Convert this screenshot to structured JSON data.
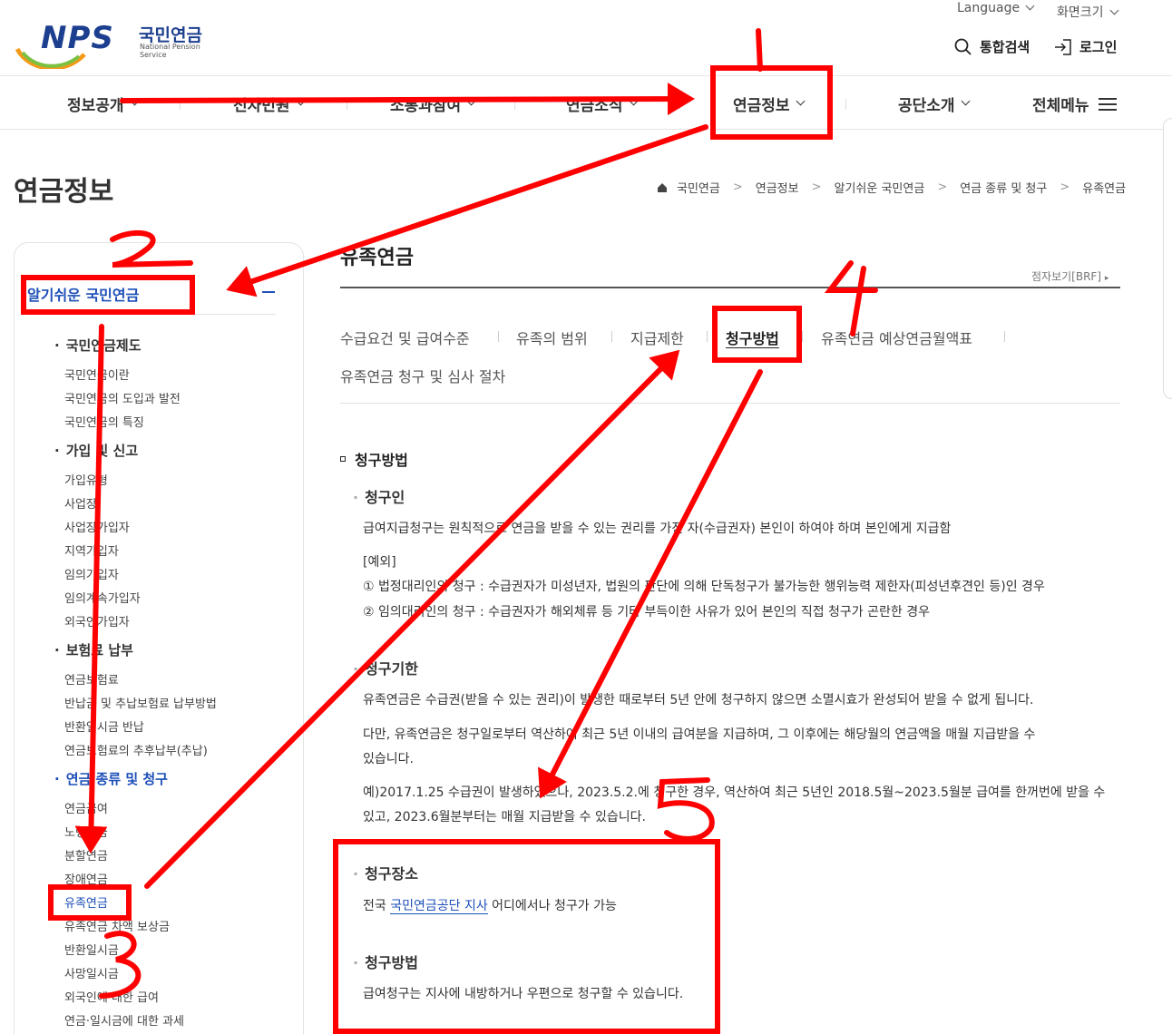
{
  "header": {
    "logo": {
      "brand": "NPS",
      "name_ko": "국민연금",
      "name_en": "National Pension Service"
    },
    "utility": {
      "language": "Language",
      "zoom": "화면크기",
      "search": "통합검색",
      "login": "로그인"
    },
    "gnb": [
      "정보공개",
      "전자민원",
      "소통과참여",
      "연금소식",
      "연금정보",
      "공단소개",
      "전체메뉴"
    ]
  },
  "page_title": "연금정보",
  "breadcrumb": [
    "국민연금",
    "연금정보",
    "알기쉬운 국민연금",
    "연금 종류 및 청구",
    "유족연금"
  ],
  "sidebar": {
    "heading": "알기쉬운 국민연금",
    "groups": [
      {
        "label": "국민연금제도",
        "items": [
          "국민연금이란",
          "국민연금의 도입과 발전",
          "국민연금의 특징"
        ]
      },
      {
        "label": "가입 및 신고",
        "items": [
          "가입유형",
          "사업장",
          "사업장가입자",
          "지역가입자",
          "임의가입자",
          "임의계속가입자",
          "외국인가입자"
        ]
      },
      {
        "label": "보험료 납부",
        "items": [
          "연금보험료",
          "반납금 및 추납보험료 납부방법",
          "반환일시금 반납",
          "연금보험료의 추후납부(추납)"
        ]
      },
      {
        "label": "연금 종류 및 청구",
        "items": [
          "연금급여",
          "노령연금",
          "분할연금",
          "장애연금",
          "유족연금",
          "유족연금 차액 보상금",
          "반환일시금",
          "사망일시금",
          "외국인에 대한 급여",
          "연금·일시금에 대한 과세"
        ]
      }
    ]
  },
  "content": {
    "title": "유족연금",
    "braille": "점자보기[BRF]",
    "tabs": [
      "수급요건 및 급여수준",
      "유족의 범위",
      "지급제한",
      "청구방법",
      "유족연금 예상연금월액표",
      "유족연금 청구 및 심사 절차"
    ],
    "section_title": "청구방법",
    "claimant": {
      "title": "청구인",
      "text": "급여지급청구는 원칙적으로 연금을 받을 수 있는 권리를 가진 자(수급권자) 본인이 하여야 하며 본인에게 지급함",
      "example_label": "[예외]",
      "example1": "① 법정대리인의 청구 : 수급권자가 미성년자, 법원의 판단에 의해 단독청구가 불가능한 행위능력 제한자(피성년후견인 등)인 경우",
      "example2": "② 임의대리인의 청구 : 수급권자가 해외체류 등 기타 부득이한 사유가 있어 본인의 직접 청구가 곤란한 경우"
    },
    "deadline": {
      "title": "청구기한",
      "p1": "유족연금은 수급권(받을 수 있는 권리)이 발생한 때로부터 5년 안에 청구하지 않으면 소멸시효가 완성되어 받을 수 없게 됩니다.",
      "p2a": "다만, 유족연금은 청구일로부터 역산하여 최근 5년 이내의 급여분을 지급하며, 그 이후에는 해당월의 연금액을 매월 지급받을 수",
      "p2b": "있습니다.",
      "p3a": "예)2017.1.25 수급권이 발생하였으나, 2023.5.2.에 청구한 경우, 역산하여 최근 5년인 2018.5월~2023.5월분 급여를 한꺼번에 받을 수",
      "p3b": "있고, 2023.6월분부터는 매월 지급받을 수 있습니다."
    },
    "place": {
      "title": "청구장소",
      "prefix": "전국",
      "link": "국민연금공단 지사",
      "suffix": "어디에서나 청구가 가능"
    },
    "method": {
      "title": "청구방법",
      "text": "급여청구는 지사에 내방하거나 우편으로 청구할 수 있습니다."
    }
  },
  "annotations": {
    "color": "#ff0000",
    "numbers": [
      "1",
      "2",
      "3",
      "4",
      "5"
    ]
  }
}
